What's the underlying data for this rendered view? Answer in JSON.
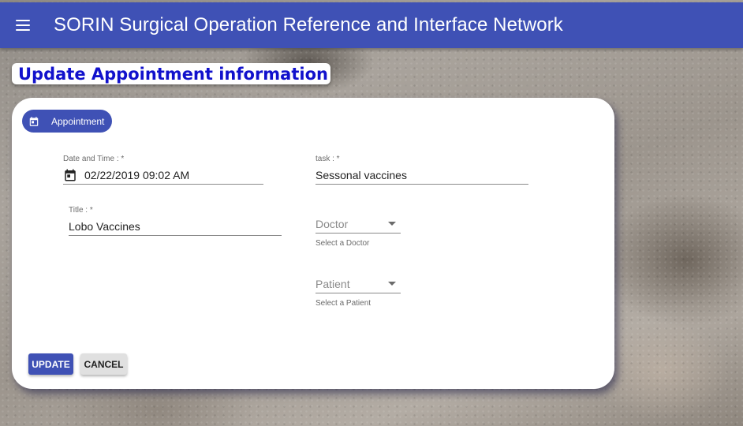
{
  "app": {
    "title": "SORIN Surgical Operation Reference and Interface Network"
  },
  "page": {
    "heading": "Update Appointment information"
  },
  "card": {
    "chip_label": "Appointment"
  },
  "form": {
    "datetime": {
      "label": "Date and Time : *",
      "value": "02/22/2019 09:02 AM"
    },
    "task": {
      "label": "task : *",
      "value": "Sessonal vaccines"
    },
    "title": {
      "label": "Title : *",
      "value": "Lobo Vaccines"
    },
    "doctor": {
      "placeholder": "Doctor",
      "helper": "Select a Doctor"
    },
    "patient": {
      "placeholder": "Patient",
      "helper": "Select a Patient"
    }
  },
  "actions": {
    "update_label": "UPDATE",
    "cancel_label": "CANCEL"
  },
  "colors": {
    "primary": "#3f51b5",
    "heading_text": "#1111cc"
  },
  "icons": {
    "menu": "menu-icon",
    "calendar": "calendar-icon",
    "dropdown": "chevron-down-icon"
  }
}
